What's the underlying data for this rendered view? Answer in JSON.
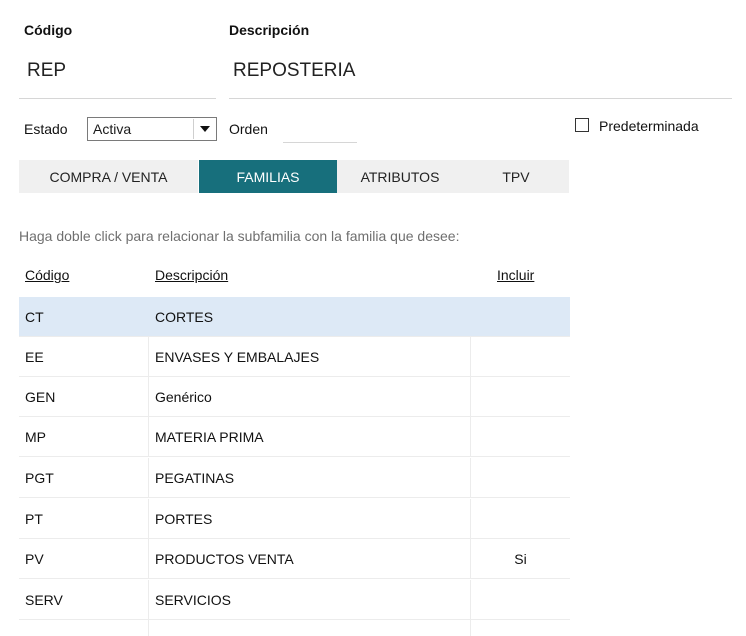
{
  "form": {
    "codigo_label": "Código",
    "codigo_value": "REP",
    "descripcion_label": "Descripción",
    "descripcion_value": "REPOSTERIA",
    "estado_label": "Estado",
    "estado_value": "Activa",
    "orden_label": "Orden",
    "orden_value": "",
    "predeterminada_label": "Predeterminada",
    "predeterminada_checked": false
  },
  "tabs": [
    {
      "label": "COMPRA / VENTA",
      "active": false
    },
    {
      "label": "FAMILIAS",
      "active": true
    },
    {
      "label": "ATRIBUTOS",
      "active": false
    },
    {
      "label": "TPV",
      "active": false
    }
  ],
  "hint": "Haga doble click para relacionar la subfamilia con la familia que desee:",
  "table": {
    "headers": [
      "Código",
      "Descripción",
      "Incluir"
    ],
    "rows": [
      {
        "codigo": "CT",
        "descripcion": "CORTES",
        "incluir": ""
      },
      {
        "codigo": "EE",
        "descripcion": "ENVASES Y EMBALAJES",
        "incluir": ""
      },
      {
        "codigo": "GEN",
        "descripcion": "Genérico",
        "incluir": ""
      },
      {
        "codigo": "MP",
        "descripcion": "MATERIA PRIMA",
        "incluir": ""
      },
      {
        "codigo": "PGT",
        "descripcion": "PEGATINAS",
        "incluir": ""
      },
      {
        "codigo": "PT",
        "descripcion": "PORTES",
        "incluir": ""
      },
      {
        "codigo": "PV",
        "descripcion": "PRODUCTOS VENTA",
        "incluir": "Si"
      },
      {
        "codigo": "SERV",
        "descripcion": "SERVICIOS",
        "incluir": ""
      }
    ]
  },
  "colors": {
    "accent": "#176f7c",
    "selected_row": "#dde9f6"
  }
}
